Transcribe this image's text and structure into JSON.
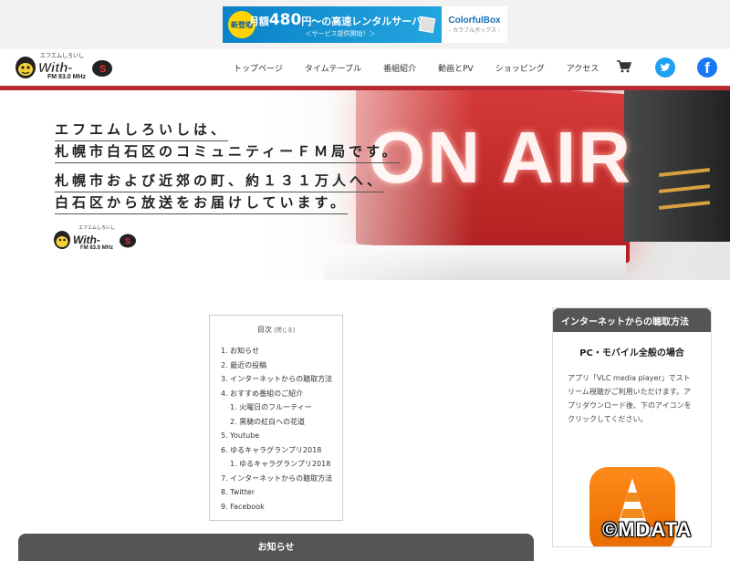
{
  "ad": {
    "badge": "新登場",
    "prefix": "月額",
    "price": "480",
    "suffix": "円〜の高速レンタルサーバー",
    "sub": "＜サービス提供開始！＞",
    "brand": "ColorfulBox",
    "brand_kana": "- カラフルボックス -"
  },
  "header": {
    "logo_text": "With-S",
    "logo_kana": "エフエムしろいし",
    "logo_freq": "FM 83.0 MHz",
    "nav": [
      "トップページ",
      "タイムテーブル",
      "番組紹介",
      "動画とPV",
      "ショッピング",
      "アクセス"
    ],
    "icons": [
      "cart-icon",
      "twitter-icon",
      "facebook-icon"
    ],
    "twitter_color": "#1da1f2",
    "facebook_color": "#1877f2",
    "accent_color": "#b82a32"
  },
  "hero": {
    "lines": [
      "エフエムしろいしは、",
      "札幌市白石区のコミュニティーＦＭ局です。",
      "札幌市および近郊の町、約１３１万人へ、",
      "白石区から放送をお届けしています。"
    ],
    "sign_text": "ON AIR"
  },
  "toc": {
    "title": "目次",
    "toggle": "[閉じる]",
    "items": [
      {
        "label": "1. お知らせ",
        "level": 1
      },
      {
        "label": "2. 最近の投稿",
        "level": 1
      },
      {
        "label": "3. インターネットからの聴取方法",
        "level": 1
      },
      {
        "label": "4. おすすめ番組のご紹介",
        "level": 1
      },
      {
        "label": "1. 火曜日のフルーティー",
        "level": 2
      },
      {
        "label": "2. 黒騎の紅白への花道",
        "level": 2
      },
      {
        "label": "5. Youtube",
        "level": 1
      },
      {
        "label": "6. ゆるキャラグランプリ2018",
        "level": 1
      },
      {
        "label": "1. ゆるキャラグランプリ2018",
        "level": 2
      },
      {
        "label": "7. インターネットからの聴取方法",
        "level": 1
      },
      {
        "label": "8. Twitter",
        "level": 1
      },
      {
        "label": "9. Facebook",
        "level": 1
      }
    ]
  },
  "news": {
    "heading": "お知らせ"
  },
  "sidebar": {
    "heading": "インターネットからの聴取方法",
    "subheading": "PC・モバイル全般の場合",
    "body": "アプリ「VLC media player」でストリーム視聴がご利用いただけます。アプリダウンロード後、下のアイコンをクリックしてください。",
    "app_icon": "vlc-icon"
  },
  "watermark": "©MDATA"
}
